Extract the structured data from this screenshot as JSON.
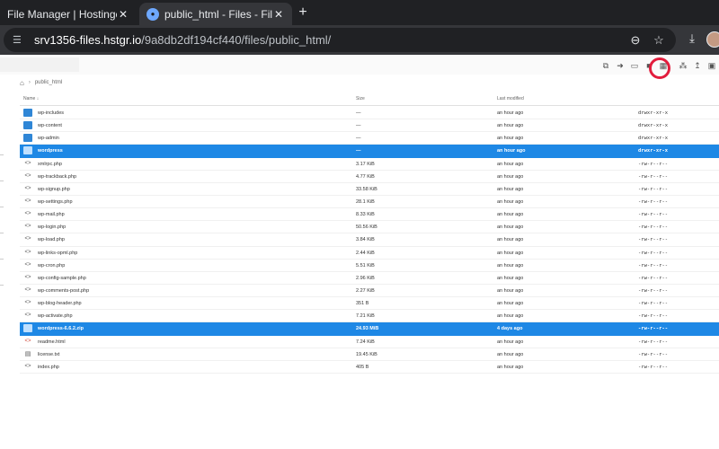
{
  "browser": {
    "tabs": [
      {
        "label": "File Manager | Hostinger",
        "close": "✕"
      },
      {
        "label": "public_html - Files - File Brow",
        "close": "✕"
      }
    ],
    "new_tab": "+",
    "url_host": "srv1356-files.hstgr.io",
    "url_path": "/9a8db2df194cf440/files/public_html/"
  },
  "breadcrumb": {
    "folder": "public_html"
  },
  "table": {
    "headers": {
      "name": "Name",
      "size": "Size",
      "modified": "Last modified"
    },
    "sort_indicator": "↓",
    "rows": [
      {
        "icon": "folder",
        "name": "wp-includes",
        "size": "—",
        "modified": "an hour ago",
        "perm": "drwxr-xr-x",
        "selected": false
      },
      {
        "icon": "folder",
        "name": "wp-content",
        "size": "—",
        "modified": "an hour ago",
        "perm": "drwxr-xr-x",
        "selected": false
      },
      {
        "icon": "folder",
        "name": "wp-admin",
        "size": "—",
        "modified": "an hour ago",
        "perm": "drwxr-xr-x",
        "selected": false
      },
      {
        "icon": "folder",
        "name": "wordpress",
        "size": "—",
        "modified": "an hour ago",
        "perm": "drwxr-xr-x",
        "selected": true
      },
      {
        "icon": "code",
        "name": "xmlrpc.php",
        "size": "3.17 KiB",
        "modified": "an hour ago",
        "perm": "-rw-r--r--",
        "selected": false
      },
      {
        "icon": "code",
        "name": "wp-trackback.php",
        "size": "4.77 KiB",
        "modified": "an hour ago",
        "perm": "-rw-r--r--",
        "selected": false
      },
      {
        "icon": "code",
        "name": "wp-signup.php",
        "size": "33.58 KiB",
        "modified": "an hour ago",
        "perm": "-rw-r--r--",
        "selected": false
      },
      {
        "icon": "code",
        "name": "wp-settings.php",
        "size": "28.1 KiB",
        "modified": "an hour ago",
        "perm": "-rw-r--r--",
        "selected": false
      },
      {
        "icon": "code",
        "name": "wp-mail.php",
        "size": "8.33 KiB",
        "modified": "an hour ago",
        "perm": "-rw-r--r--",
        "selected": false
      },
      {
        "icon": "code",
        "name": "wp-login.php",
        "size": "50.56 KiB",
        "modified": "an hour ago",
        "perm": "-rw-r--r--",
        "selected": false
      },
      {
        "icon": "code",
        "name": "wp-load.php",
        "size": "3.84 KiB",
        "modified": "an hour ago",
        "perm": "-rw-r--r--",
        "selected": false
      },
      {
        "icon": "code",
        "name": "wp-links-opml.php",
        "size": "2.44 KiB",
        "modified": "an hour ago",
        "perm": "-rw-r--r--",
        "selected": false
      },
      {
        "icon": "code",
        "name": "wp-cron.php",
        "size": "5.51 KiB",
        "modified": "an hour ago",
        "perm": "-rw-r--r--",
        "selected": false
      },
      {
        "icon": "code",
        "name": "wp-config-sample.php",
        "size": "2.96 KiB",
        "modified": "an hour ago",
        "perm": "-rw-r--r--",
        "selected": false
      },
      {
        "icon": "code",
        "name": "wp-comments-post.php",
        "size": "2.27 KiB",
        "modified": "an hour ago",
        "perm": "-rw-r--r--",
        "selected": false
      },
      {
        "icon": "code",
        "name": "wp-blog-header.php",
        "size": "351 B",
        "modified": "an hour ago",
        "perm": "-rw-r--r--",
        "selected": false
      },
      {
        "icon": "code",
        "name": "wp-activate.php",
        "size": "7.21 KiB",
        "modified": "an hour ago",
        "perm": "-rw-r--r--",
        "selected": false
      },
      {
        "icon": "folder",
        "name": "wordpress-6.6.2.zip",
        "size": "24.93 MiB",
        "modified": "4 days ago",
        "perm": "-rw-r--r--",
        "selected": true
      },
      {
        "icon": "code-red",
        "name": "readme.html",
        "size": "7.24 KiB",
        "modified": "an hour ago",
        "perm": "-rw-r--r--",
        "selected": false
      },
      {
        "icon": "doc",
        "name": "license.txt",
        "size": "19.45 KiB",
        "modified": "an hour ago",
        "perm": "-rw-r--r--",
        "selected": false
      },
      {
        "icon": "code",
        "name": "index.php",
        "size": "405 B",
        "modified": "an hour ago",
        "perm": "-rw-r--r--",
        "selected": false
      }
    ]
  },
  "colors": {
    "selection": "#1e88e5",
    "folder": "#2f86d6",
    "highlight_ring": "#e21d3d"
  }
}
